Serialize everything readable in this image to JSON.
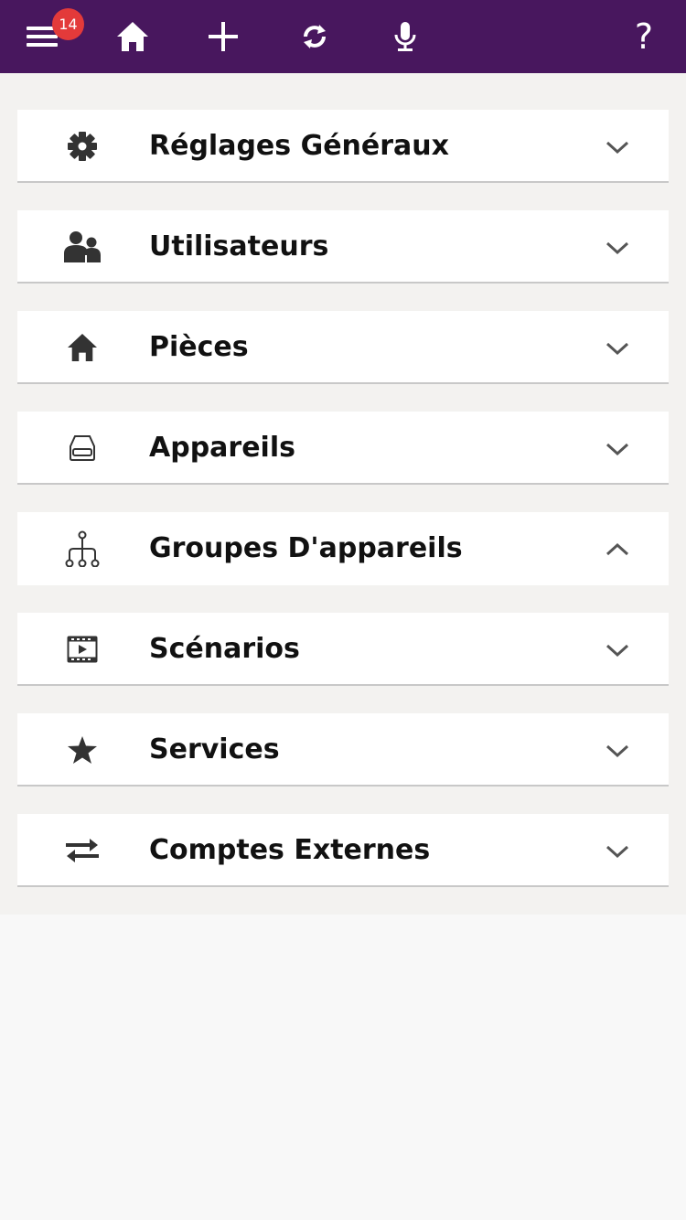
{
  "colors": {
    "topbar": "#48175e",
    "badge": "#e33a3a",
    "icon": "#333333",
    "chevron": "#555555"
  },
  "topbar": {
    "menu_badge": "14",
    "help_label": "?",
    "icons": [
      "menu-icon",
      "home-icon",
      "plus-icon",
      "refresh-icon",
      "microphone-icon",
      "help-icon"
    ]
  },
  "sections": [
    {
      "label": "Réglages Généraux",
      "icon": "gear-icon",
      "expanded": false
    },
    {
      "label": "Utilisateurs",
      "icon": "users-icon",
      "expanded": false
    },
    {
      "label": "Pièces",
      "icon": "home-icon",
      "expanded": false
    },
    {
      "label": "Appareils",
      "icon": "device-icon",
      "expanded": false
    },
    {
      "label": "Groupes D'appareils",
      "icon": "device-group-icon",
      "expanded": true
    },
    {
      "label": "Scénarios",
      "icon": "film-icon",
      "expanded": false
    },
    {
      "label": "Services",
      "icon": "star-icon",
      "expanded": false
    },
    {
      "label": "Comptes Externes",
      "icon": "transfer-icon",
      "expanded": false
    }
  ]
}
